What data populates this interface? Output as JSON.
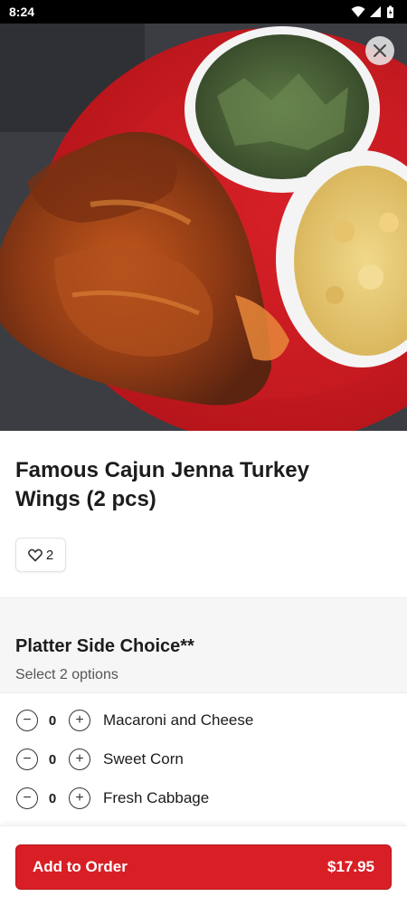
{
  "status_bar": {
    "time": "8:24"
  },
  "hero": {
    "close_icon": "close-icon"
  },
  "item": {
    "title": "Famous Cajun Jenna Turkey Wings (2 pcs)",
    "likes": "2"
  },
  "section": {
    "title": "Platter Side Choice**",
    "subtitle": "Select 2 options"
  },
  "options": [
    {
      "label": "Macaroni and Cheese",
      "qty": "0"
    },
    {
      "label": "Sweet Corn",
      "qty": "0"
    },
    {
      "label": "Fresh Cabbage",
      "qty": "0"
    }
  ],
  "order": {
    "button_label": "Add to Order",
    "price": "$17.95"
  },
  "colors": {
    "accent": "#d91f26"
  }
}
